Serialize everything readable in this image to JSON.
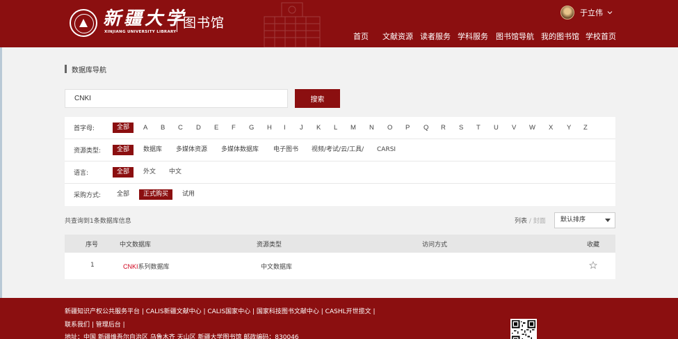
{
  "header": {
    "logo_cn": "新疆大学",
    "logo_en": "XINJIANG UNIVERSITY LIBRARY",
    "logo_library": "图书馆",
    "user_name": "于立伟",
    "nav": [
      "首页",
      "文献资源",
      "读者服务",
      "学科服务",
      "图书馆导航",
      "我的图书馆",
      "学校首页"
    ]
  },
  "page_title": "数据库导航",
  "search": {
    "value": "CNKI",
    "button_label": "搜索"
  },
  "filters": {
    "initial": {
      "label": "首字母:",
      "all": "全部",
      "letters": [
        "A",
        "B",
        "C",
        "D",
        "E",
        "F",
        "G",
        "H",
        "I",
        "J",
        "K",
        "L",
        "M",
        "N",
        "O",
        "P",
        "Q",
        "R",
        "S",
        "T",
        "U",
        "V",
        "W",
        "X",
        "Y",
        "Z"
      ]
    },
    "resource_type": {
      "label": "资源类型:",
      "options": [
        "全部",
        "数据库",
        "多媒体资源",
        "多媒体数据库",
        "电子图书",
        "视频/考试/云/工具/",
        "CARSI"
      ],
      "active": "全部"
    },
    "language": {
      "label": "语言:",
      "options": [
        "全部",
        "外文",
        "中文"
      ],
      "active": "全部"
    },
    "purchase": {
      "label": "采购方式:",
      "options": [
        "全部",
        "正式购买",
        "试用"
      ],
      "active": "正式购买"
    }
  },
  "results": {
    "summary": "共查询到1条数据库信息",
    "view_list": "列表",
    "view_sep": " / ",
    "view_cover": "封面",
    "sort": "默认排序"
  },
  "table": {
    "headers": [
      "序号",
      "中文数据库",
      "资源类型",
      "访问方式",
      "收藏"
    ],
    "rows": [
      {
        "index": "1",
        "name_highlight": "CNKI",
        "name_rest": "系列数据库",
        "type": "中文数据库",
        "access": ""
      }
    ]
  },
  "footer": {
    "links_line1": "新疆知识产权公共服务平台 | CALIS新疆文献中心 | CALIS国家中心 | 国家科技图书文献中心 | CASHL开世揽文 |",
    "links_line2": "联系我们 | 管理后台 |",
    "address": "地址：中国 新疆维吾尔自治区 乌鲁木齐 天山区 新疆大学图书馆   邮政编码：830046"
  },
  "colors": {
    "brand": "#8b0f10",
    "highlight": "#d0021b"
  }
}
